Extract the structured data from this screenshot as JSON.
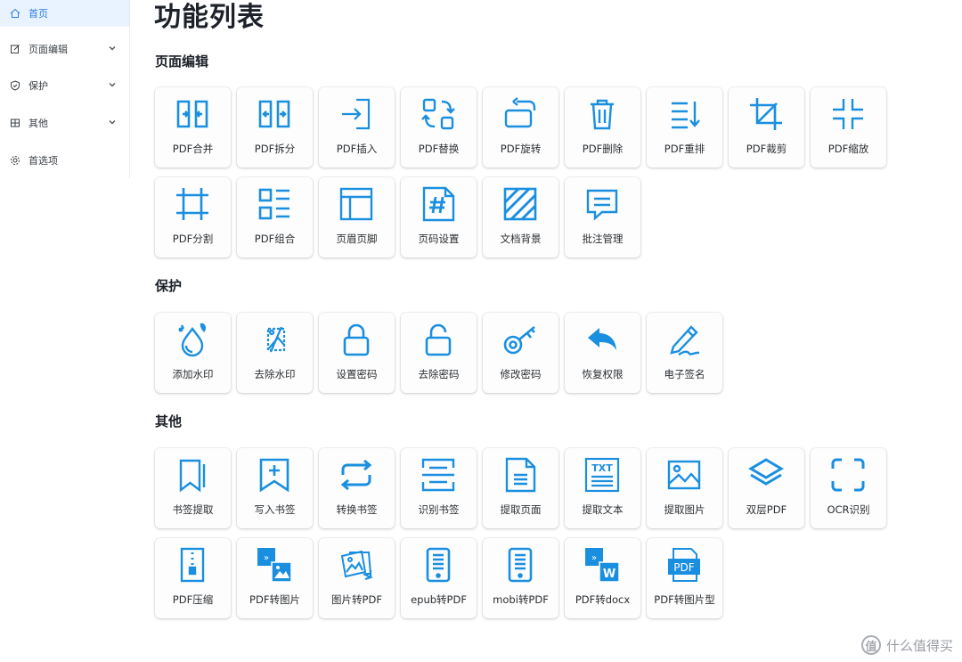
{
  "sidebar": {
    "items": [
      {
        "label": "首页",
        "icon": "home-icon",
        "active": true
      },
      {
        "label": "页面编辑",
        "icon": "edit-icon",
        "expandable": true
      },
      {
        "label": "保护",
        "icon": "shield-icon",
        "expandable": true
      },
      {
        "label": "其他",
        "icon": "grid-icon",
        "expandable": true
      },
      {
        "label": "首选项",
        "icon": "gear-icon"
      }
    ]
  },
  "main": {
    "title": "功能列表",
    "sections": [
      {
        "title": "页面编辑",
        "tiles": [
          {
            "label": "PDF合并",
            "icon": "merge-icon"
          },
          {
            "label": "PDF拆分",
            "icon": "split-icon"
          },
          {
            "label": "PDF插入",
            "icon": "insert-icon"
          },
          {
            "label": "PDF替换",
            "icon": "replace-icon"
          },
          {
            "label": "PDF旋转",
            "icon": "rotate-icon"
          },
          {
            "label": "PDF删除",
            "icon": "trash-icon"
          },
          {
            "label": "PDF重排",
            "icon": "reorder-icon"
          },
          {
            "label": "PDF裁剪",
            "icon": "crop-icon"
          },
          {
            "label": "PDF缩放",
            "icon": "shrink-icon"
          },
          {
            "label": "PDF分割",
            "icon": "divide-icon"
          },
          {
            "label": "PDF组合",
            "icon": "combine-icon"
          },
          {
            "label": "页眉页脚",
            "icon": "header-footer-icon"
          },
          {
            "label": "页码设置",
            "icon": "page-number-icon"
          },
          {
            "label": "文档背景",
            "icon": "background-icon"
          },
          {
            "label": "批注管理",
            "icon": "comment-icon"
          }
        ]
      },
      {
        "title": "保护",
        "tiles": [
          {
            "label": "添加水印",
            "icon": "watermark-add-icon"
          },
          {
            "label": "去除水印",
            "icon": "watermark-remove-icon"
          },
          {
            "label": "设置密码",
            "icon": "lock-icon"
          },
          {
            "label": "去除密码",
            "icon": "unlock-icon"
          },
          {
            "label": "修改密码",
            "icon": "key-icon"
          },
          {
            "label": "恢复权限",
            "icon": "undo-icon"
          },
          {
            "label": "电子签名",
            "icon": "signature-icon"
          }
        ]
      },
      {
        "title": "其他",
        "tiles": [
          {
            "label": "书签提取",
            "icon": "bookmark-icon"
          },
          {
            "label": "写入书签",
            "icon": "bookmark-add-icon"
          },
          {
            "label": "转换书签",
            "icon": "convert-icon"
          },
          {
            "label": "识别书签",
            "icon": "scan-icon"
          },
          {
            "label": "提取页面",
            "icon": "page-extract-icon"
          },
          {
            "label": "提取文本",
            "icon": "text-extract-icon"
          },
          {
            "label": "提取图片",
            "icon": "image-extract-icon"
          },
          {
            "label": "双层PDF",
            "icon": "layers-icon"
          },
          {
            "label": "OCR识别",
            "icon": "ocr-icon"
          },
          {
            "label": "PDF压缩",
            "icon": "compress-icon"
          },
          {
            "label": "PDF转图片",
            "icon": "pdf-to-image-icon"
          },
          {
            "label": "图片转PDF",
            "icon": "image-to-pdf-icon"
          },
          {
            "label": "epub转PDF",
            "icon": "epub-icon"
          },
          {
            "label": "mobi转PDF",
            "icon": "mobi-icon"
          },
          {
            "label": "PDF转docx",
            "icon": "docx-icon"
          },
          {
            "label": "PDF转图片型",
            "icon": "pdf-image-type-icon"
          }
        ]
      }
    ]
  },
  "watermark": {
    "text": "什么值得买",
    "logo": "值"
  },
  "colors": {
    "accent": "#1a8fe0",
    "active_bg": "#e8f3ff",
    "active_text": "#2c7be5"
  }
}
